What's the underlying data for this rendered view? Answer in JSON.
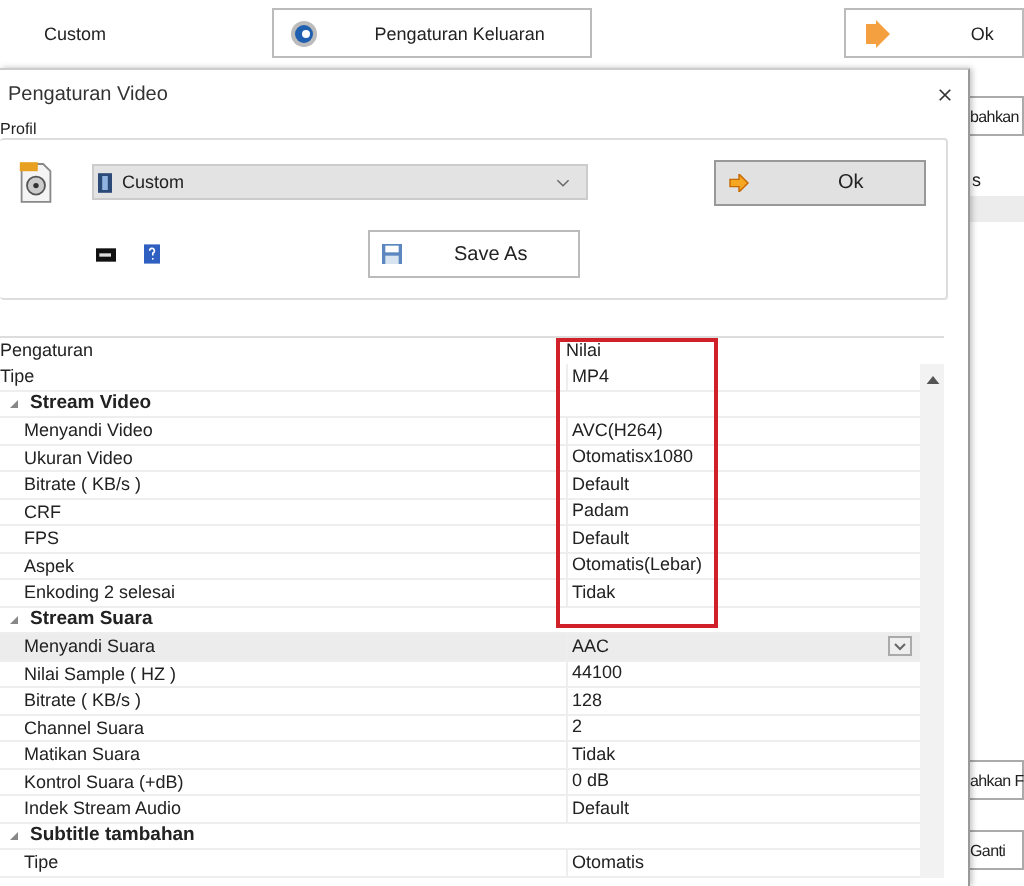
{
  "background_window": {
    "profile_label": "Custom",
    "output_settings_button": "Pengaturan Keluaran",
    "ok_button": "Ok",
    "side_items": [
      {
        "kind": "button",
        "text": "bahkan"
      },
      {
        "kind": "label",
        "text": "s"
      },
      {
        "kind": "button",
        "text": "ahkan F"
      },
      {
        "kind": "button",
        "text": "Ganti"
      }
    ]
  },
  "dialog": {
    "title": "Pengaturan Video",
    "profile_group": {
      "label": "Profil",
      "profile": "Custom",
      "ok_button": "Ok",
      "save_as_button": "Save As"
    },
    "grid": {
      "columns": [
        "Pengaturan",
        "Nilai"
      ],
      "rows": [
        {
          "kind": "property",
          "name": "Tipe",
          "value": "MP4",
          "selected": false
        },
        {
          "kind": "category",
          "name": "Stream Video",
          "expanded": true,
          "children": [
            {
              "kind": "property",
              "name": "Menyandi Video",
              "value": "AVC(H264)",
              "selected": false
            },
            {
              "kind": "property",
              "name": "Ukuran Video",
              "value": "Otomatisx1080",
              "selected": false
            },
            {
              "kind": "property",
              "name": "Bitrate ( KB/s )",
              "value": "Default",
              "selected": false
            },
            {
              "kind": "property",
              "name": "CRF",
              "value": "Padam",
              "selected": false
            },
            {
              "kind": "property",
              "name": "FPS",
              "value": "Default",
              "selected": false
            },
            {
              "kind": "property",
              "name": "Aspek",
              "value": "Otomatis(Lebar)",
              "selected": false
            },
            {
              "kind": "property",
              "name": "Enkoding 2 selesai",
              "value": "Tidak",
              "selected": false
            }
          ]
        },
        {
          "kind": "category",
          "name": "Stream Suara",
          "expanded": true,
          "children": [
            {
              "kind": "property",
              "name": "Menyandi Suara",
              "value": "AAC",
              "selected": true
            },
            {
              "kind": "property",
              "name": "Nilai Sample ( HZ )",
              "value": "44100",
              "selected": false
            },
            {
              "kind": "property",
              "name": "Bitrate ( KB/s )",
              "value": "128",
              "selected": false
            },
            {
              "kind": "property",
              "name": "Channel Suara",
              "value": "2",
              "selected": false
            },
            {
              "kind": "property",
              "name": "Matikan Suara",
              "value": "Tidak",
              "selected": false
            },
            {
              "kind": "property",
              "name": "Kontrol Suara (+dB)",
              "value": "0 dB",
              "selected": false
            },
            {
              "kind": "property",
              "name": "Indek Stream Audio",
              "value": "Default",
              "selected": false
            }
          ]
        },
        {
          "kind": "category",
          "name": "Subtitle tambahan",
          "expanded": true,
          "children": [
            {
              "kind": "property",
              "name": "Tipe",
              "value": "Otomatis",
              "selected": false
            }
          ]
        }
      ]
    }
  }
}
